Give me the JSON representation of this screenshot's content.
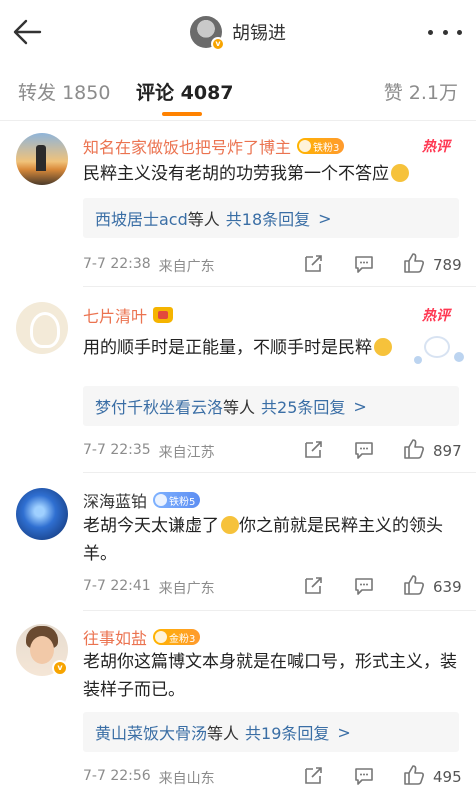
{
  "header": {
    "title": "胡锡进",
    "verified_mark": "v",
    "back_icon": "back-arrow-icon",
    "more_icon": "more-dots-icon"
  },
  "tabs": [
    {
      "label": "转发",
      "count": "1850"
    },
    {
      "label": "评论",
      "count": "4087"
    },
    {
      "label": "赞",
      "count": "2.1万"
    }
  ],
  "accent_color": "#ff8200",
  "comments": [
    {
      "name": "知名在家做饭也把号炸了博主",
      "badge": "铁粉3",
      "hot": "热评",
      "text": "民粹主义没有老胡的功劳我第一个不答应",
      "reply_who": "西坡居士acd",
      "reply_etc": "等人",
      "reply_count": "共18条回复",
      "reply_arrow": ">",
      "date": "7-7 22:38",
      "location": "来自广东",
      "likes": "789"
    },
    {
      "name": "七片清叶",
      "badge": "",
      "hot": "热评",
      "text": "用的顺手时是正能量，不顺手时是民粹",
      "reply_who": "梦付千秋坐看云洛",
      "reply_etc": "等人",
      "reply_count": "共25条回复",
      "reply_arrow": ">",
      "date": "7-7 22:35",
      "location": "来自江苏",
      "likes": "897"
    },
    {
      "name": "深海蓝铂",
      "badge": "铁粉5",
      "hot": "",
      "text_a": "老胡今天太谦虚了",
      "text_b": "你之前就是民粹主义的领头羊。",
      "date": "7-7 22:41",
      "location": "来自广东",
      "likes": "639"
    },
    {
      "name": "往事如盐",
      "badge": "金粉3",
      "hot": "",
      "text": "老胡你这篇博文本身就是在喊口号，形式主义，装装样子而已。",
      "reply_who": "黄山菜饭大骨汤",
      "reply_etc": "等人",
      "reply_count": "共19条回复",
      "reply_arrow": ">",
      "date": "7-7 22:56",
      "location": "来自山东",
      "likes": "495"
    }
  ]
}
